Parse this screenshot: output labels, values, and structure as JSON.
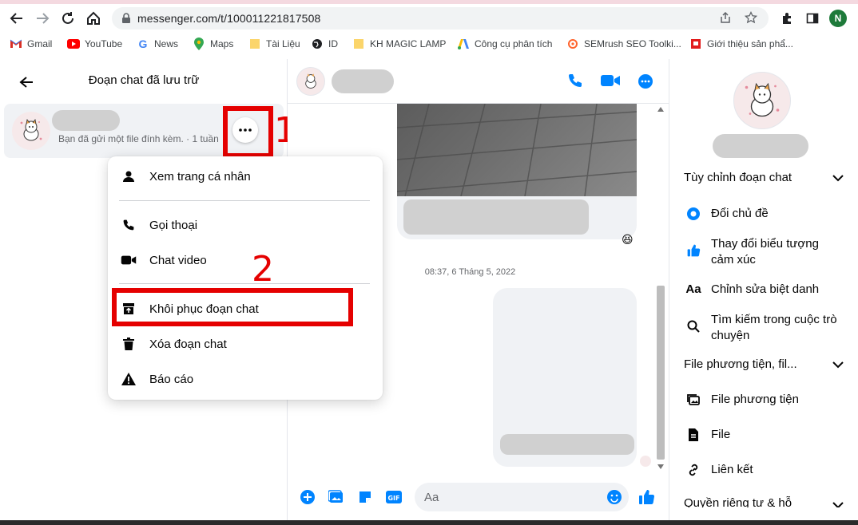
{
  "browser": {
    "url": "messenger.com/t/100011221817508",
    "profile_initial": "N",
    "bookmarks": [
      "Gmail",
      "YouTube",
      "News",
      "Maps",
      "Tài Liệu",
      "ID",
      "KH MAGIC LAMP",
      "Công cụ phân tích",
      "SEMrush SEO Toolki...",
      "Giới thiệu sản phẩ..."
    ]
  },
  "left": {
    "title": "Đoạn chat đã lưu trữ",
    "conversation_preview": "Bạn đã gửi một file đính kèm. · 1 tuần"
  },
  "menu": {
    "items": [
      "Xem trang cá nhân",
      "Gọi thoại",
      "Chat video",
      "Khôi phục đoạn chat",
      "Xóa đoạn chat",
      "Báo cáo"
    ]
  },
  "annotations": {
    "one": "1",
    "two": "2"
  },
  "chat": {
    "timestamp": "08:37, 6 Tháng 5, 2022",
    "input_placeholder": "Aa",
    "reaction": "😆"
  },
  "right": {
    "section_customize": "Tùy chỉnh đoạn chat",
    "items_customize": [
      "Đổi chủ đề",
      "Thay đổi biểu tượng cảm xúc",
      "Chỉnh sửa biệt danh",
      "Tìm kiếm trong cuộc trò chuyện"
    ],
    "section_files": "File phương tiện, fil...",
    "items_files": [
      "File phương tiện",
      "File",
      "Liên kết"
    ],
    "section_privacy": "Quyền riêng tư & hỗ"
  },
  "colors": {
    "accent": "#0084ff",
    "annotation": "#e50000"
  }
}
